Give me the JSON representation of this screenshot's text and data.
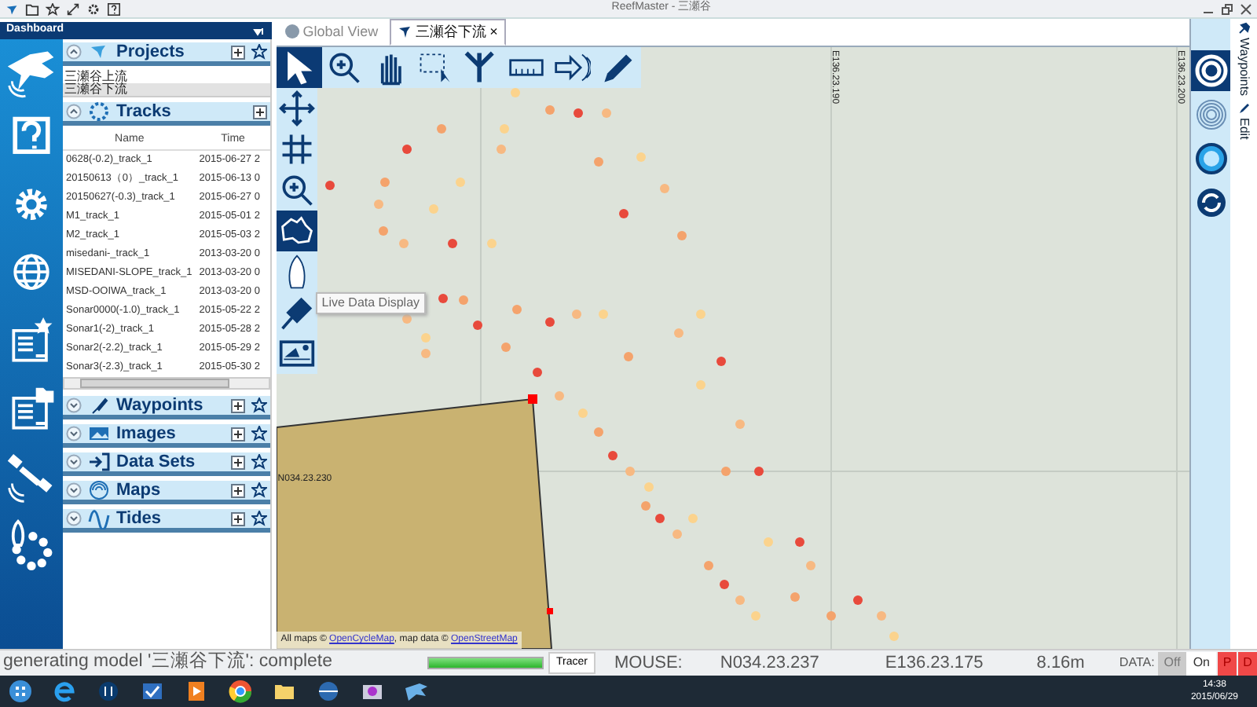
{
  "window": {
    "title": "ReefMaster - 三瀬谷"
  },
  "dashboard": {
    "title": "Dashboard"
  },
  "sections": [
    {
      "title": "Projects",
      "expanded": true,
      "items": [
        {
          "label": "三瀬谷上流",
          "selected": false
        },
        {
          "label": "三瀬谷下流",
          "selected": true
        }
      ]
    },
    {
      "title": "Tracks",
      "expanded": true,
      "table": {
        "columns": [
          "Name",
          "Time"
        ],
        "rows": [
          [
            "0628(-0.2)_track_1",
            "2015-06-27 2"
          ],
          [
            "20150613（0）_track_1",
            "2015-06-13 0"
          ],
          [
            "20150627(-0.3)_track_1",
            "2015-06-27 0"
          ],
          [
            "M1_track_1",
            "2015-05-01 2"
          ],
          [
            "M2_track_1",
            "2015-05-03 2"
          ],
          [
            "misedani-_track_1",
            "2013-03-20 0"
          ],
          [
            "MISEDANI-SLOPE_track_1",
            "2013-03-20 0"
          ],
          [
            "MSD-OOIWA_track_1",
            "2013-03-20 0"
          ],
          [
            "Sonar0000(-1.0)_track_1",
            "2015-05-22 2"
          ],
          [
            "Sonar1(-2)_track_1",
            "2015-05-28 2"
          ],
          [
            "Sonar2(-2.2)_track_1",
            "2015-05-29 2"
          ],
          [
            "Sonar3(-2.3)_track_1",
            "2015-05-30 2"
          ]
        ]
      }
    },
    {
      "title": "Waypoints",
      "expanded": false
    },
    {
      "title": "Images",
      "expanded": false
    },
    {
      "title": "Data Sets",
      "expanded": false
    },
    {
      "title": "Maps",
      "expanded": false
    },
    {
      "title": "Tides",
      "expanded": false
    }
  ],
  "tabs": [
    {
      "label": "Global View",
      "selected": false
    },
    {
      "label": "三瀬谷下流",
      "selected": true,
      "close": "×"
    }
  ],
  "map": {
    "tools_top": [
      {
        "selected": true
      },
      {
        "selected": false
      },
      {
        "selected": false
      },
      {
        "selected": false
      },
      {
        "selected": false
      },
      {
        "selected": false
      },
      {
        "selected": false
      },
      {
        "selected": false
      }
    ],
    "tools_left": [
      {
        "selected": false
      },
      {
        "selected": false
      },
      {
        "selected": false
      },
      {
        "selected": true
      },
      {
        "selected": false
      },
      {
        "selected": false
      },
      {
        "selected": false
      }
    ],
    "grid_labels": [
      {
        "kind": "vertical",
        "text": "E136.23.190"
      },
      {
        "kind": "vertical",
        "text": "E136.23.200"
      },
      {
        "kind": "horizontal",
        "text": "N034.23.230"
      }
    ],
    "tooltip": "Live Data Display",
    "attribution": {
      "prefix": "All maps ©",
      "link1": "OpenCycleMap",
      "middle": ", map data ©",
      "link2": "OpenStreetMap"
    }
  },
  "right_rail": [
    {
      "selected": true
    },
    {
      "selected": false
    },
    {
      "selected": false
    },
    {
      "selected": false
    }
  ],
  "side_tabs": [
    "Waypoints",
    "Edit"
  ],
  "status_bar": {
    "message": "generating model '三瀬谷下流': complete",
    "progress": {
      "level": 1
    },
    "tracer": "Tracer",
    "mouse_label": "MOUSE:",
    "lat": "N034.23.237",
    "lon": "E136.23.175",
    "depth": "8.16m",
    "data_label": "DATA:",
    "data_options": [
      {
        "label": "Off",
        "selected": true
      },
      {
        "label": "On",
        "selected": false
      }
    ],
    "flags": [
      "P",
      "D"
    ]
  },
  "taskbar": {
    "time": "14:38",
    "date": "2015/06/29"
  }
}
